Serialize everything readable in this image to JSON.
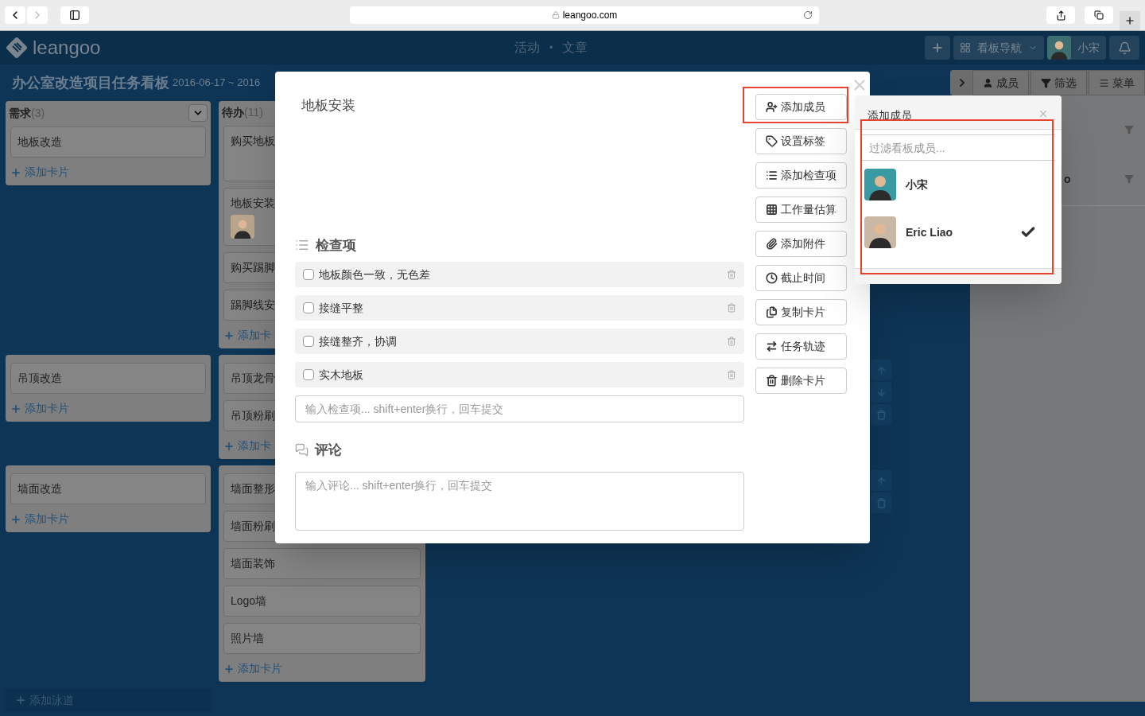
{
  "browser": {
    "url": "leangoo.com"
  },
  "app_header": {
    "logo": "leangoo",
    "nav": [
      {
        "label": "活动"
      },
      {
        "label": "文章"
      }
    ],
    "nav_separator": "•",
    "board_nav": "看板导航",
    "user": "小宋"
  },
  "board": {
    "title": "办公室改造项目任务看板",
    "dates": "2016-06-17 ~ 2016",
    "toolbar": [
      {
        "label": "成员",
        "kind": "members"
      },
      {
        "label": "筛选",
        "kind": "filter"
      },
      {
        "label": "菜单",
        "kind": "menu"
      }
    ]
  },
  "columns": [
    {
      "name": "需求",
      "count": "(3)"
    },
    {
      "name": "待办",
      "count": "(11)"
    }
  ],
  "lanes": [
    {
      "cells": [
        {
          "cards": [
            {
              "title": "地板改造"
            }
          ],
          "add": "添加卡片"
        },
        {
          "cards": [
            {
              "title": "购买地板",
              "tall": true
            },
            {
              "title": "地板安装",
              "avatar": true
            },
            {
              "title": "购买踢脚"
            },
            {
              "title": "踢脚线安"
            }
          ],
          "add": "添加卡"
        }
      ]
    },
    {
      "cells": [
        {
          "cards": [
            {
              "title": "吊顶改造"
            }
          ],
          "add": "添加卡片"
        },
        {
          "cards": [
            {
              "title": "吊顶龙骨"
            },
            {
              "title": "吊顶粉刷"
            }
          ],
          "add": "添加卡"
        }
      ],
      "controls": [
        {
          "kind": "up"
        },
        {
          "kind": "down"
        },
        {
          "kind": "delete"
        }
      ]
    },
    {
      "cells": [
        {
          "cards": [
            {
              "title": "墙面改造"
            }
          ],
          "add": "添加卡片"
        },
        {
          "cards": [
            {
              "title": "墙面整形"
            },
            {
              "title": "墙面粉刷"
            },
            {
              "title": "墙面装饰"
            },
            {
              "title": "Logo墙"
            },
            {
              "title": "照片墙"
            }
          ],
          "add": "添加卡片"
        }
      ],
      "controls": [
        {
          "kind": "up"
        },
        {
          "kind": "delete"
        }
      ]
    }
  ],
  "add_lane": "添加泳道",
  "right_panel": {
    "member_rows": [
      {
        "kind": "hidden"
      },
      {
        "kind": "named",
        "name": "o"
      }
    ]
  },
  "card_modal": {
    "title": "地板安装",
    "checklist": {
      "heading": "检查项",
      "items": [
        {
          "text": "地板颜色一致，无色差",
          "checked": false
        },
        {
          "text": "接缝平整",
          "checked": false
        },
        {
          "text": "接缝整齐，协调",
          "checked": false
        },
        {
          "text": "实木地板",
          "checked": false
        }
      ],
      "placeholder": "输入检查项... shift+enter换行，回车提交"
    },
    "comments": {
      "heading": "评论",
      "placeholder": "输入评论... shift+enter换行，回车提交"
    },
    "actions": [
      {
        "label": "添加成员",
        "kind": "member",
        "highlighted": true
      },
      {
        "label": "设置标签",
        "kind": "tag",
        "highlighted": false
      },
      {
        "label": "添加检查项",
        "kind": "list",
        "highlighted": false
      },
      {
        "label": "工作量估算",
        "kind": "grid",
        "highlighted": false
      },
      {
        "label": "添加附件",
        "kind": "attach",
        "highlighted": false
      },
      {
        "label": "截止时间",
        "kind": "clock",
        "highlighted": false
      },
      {
        "label": "复制卡片",
        "kind": "copy",
        "highlighted": false
      },
      {
        "label": "任务轨迹",
        "kind": "exchange",
        "highlighted": false
      },
      {
        "label": "删除卡片",
        "kind": "trash",
        "highlighted": false
      }
    ]
  },
  "member_popover": {
    "title": "添加成员",
    "placeholder": "过滤看板成员...",
    "highlighted": true,
    "members": [
      {
        "name": "小宋",
        "selected": false
      },
      {
        "name": "Eric Liao",
        "selected": true
      }
    ]
  }
}
